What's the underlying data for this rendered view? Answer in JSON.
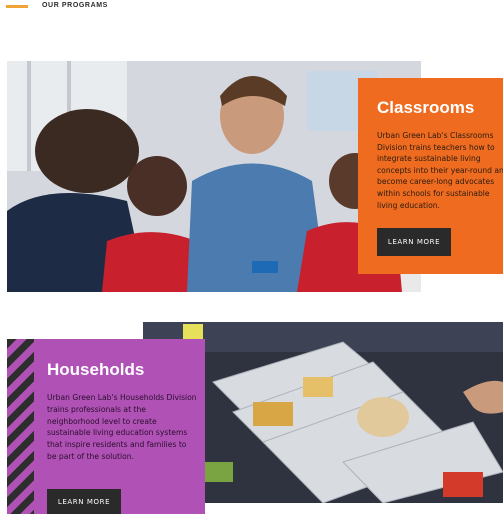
{
  "section": {
    "eyebrow": "OUR PROGRAMS",
    "accent_color": "#f0a437"
  },
  "programs": [
    {
      "title": "Classrooms",
      "description": "Urban Green Lab's Classrooms Division trains teachers how to integrate sustainable living concepts into their year-round and become career-long advocates within schools for sustainable living education.",
      "button_label": "LEARN MORE",
      "card_color": "#ee6b1f"
    },
    {
      "title": "Households",
      "description": "Urban Green Lab's Households Division trains professionals at the neighborhood level to create sustainable living education systems that inspire residents and families to be part of the solution.",
      "button_label": "LEARN MORE",
      "card_color": "#b051b6"
    }
  ]
}
